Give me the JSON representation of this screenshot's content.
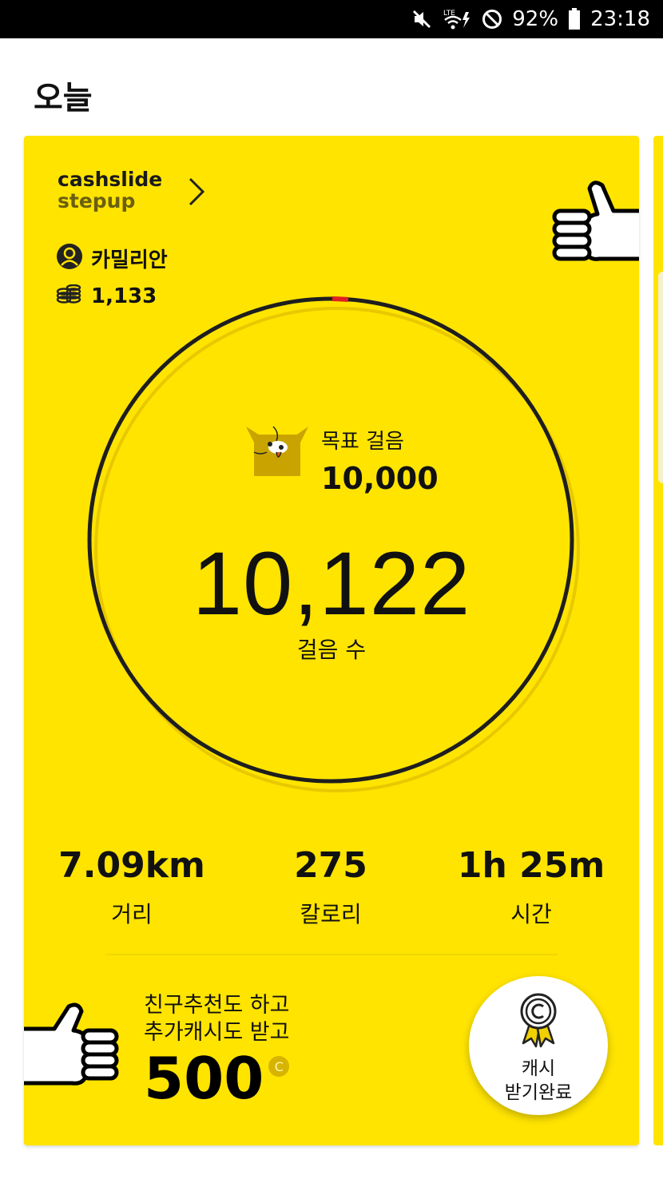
{
  "status_bar": {
    "battery_percent": "92%",
    "time": "23:18",
    "network_label": "LTE",
    "icons": [
      "mute-icon",
      "lte-signal-icon",
      "do-not-disturb-icon",
      "battery-icon"
    ]
  },
  "page": {
    "title": "오늘"
  },
  "card": {
    "brand": {
      "line1": "cashslide",
      "line2": "stepup"
    },
    "user": {
      "name": "카밀리안",
      "coins": "1,133"
    },
    "goal": {
      "label": "목표 걸음",
      "value": "10,000"
    },
    "steps": {
      "value": "10,122",
      "label": "걸음 수",
      "progress_fraction": 1.0
    },
    "stats": [
      {
        "value": "7.09km",
        "label": "거리"
      },
      {
        "value": "275",
        "label": "칼로리"
      },
      {
        "value": "1h 25m",
        "label": "시간"
      }
    ],
    "promo": {
      "line1": "친구추천도 하고",
      "line2": "추가캐시도 받고",
      "amount": "500",
      "currency_badge": "C"
    },
    "cash_button": {
      "line1": "캐시",
      "line2": "받기완료"
    }
  },
  "colors": {
    "card_yellow": "#ffe400",
    "ring_dark": "#1e1e1e",
    "ring_marker": "#e02020",
    "mascot_brown": "#c9a400"
  }
}
